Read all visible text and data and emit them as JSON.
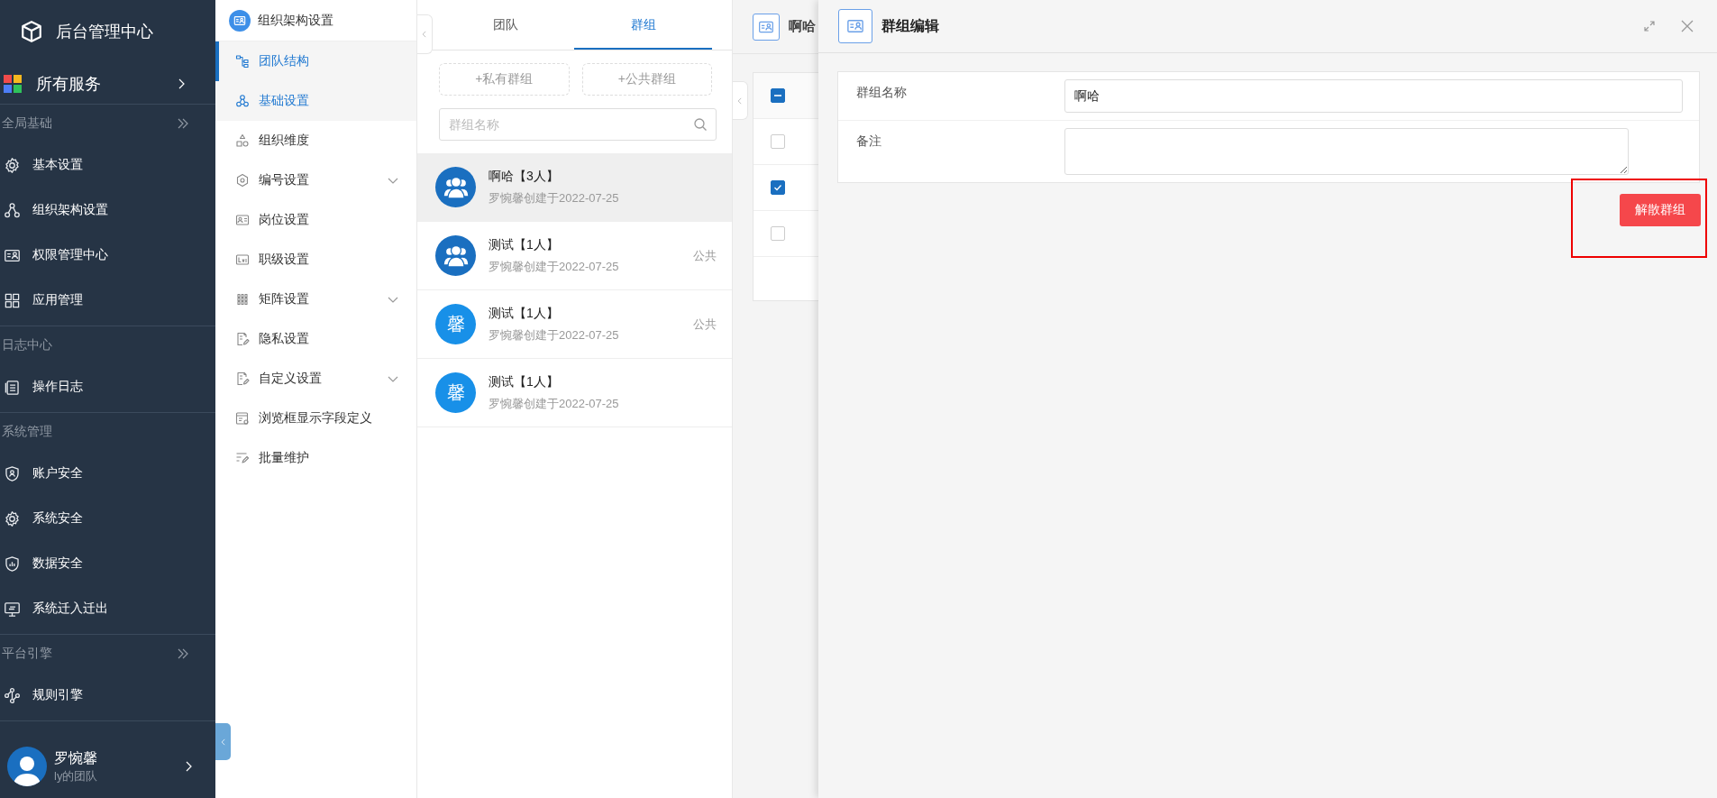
{
  "nav": {
    "title": "后台管理中心",
    "all_services": "所有服务",
    "sections": [
      {
        "title": "全局基础",
        "has_toggle": true,
        "items": [
          {
            "label": "基本设置",
            "kind": "gear"
          },
          {
            "label": "组织架构设置",
            "kind": "org"
          },
          {
            "label": "权限管理中心",
            "kind": "card"
          },
          {
            "label": "应用管理",
            "kind": "grid"
          }
        ]
      },
      {
        "title": "日志中心",
        "has_toggle": false,
        "items": [
          {
            "label": "操作日志",
            "kind": "log"
          }
        ]
      },
      {
        "title": "系统管理",
        "has_toggle": false,
        "items": [
          {
            "label": "账户安全",
            "kind": "shield_user"
          },
          {
            "label": "系统安全",
            "kind": "gear"
          },
          {
            "label": "数据安全",
            "kind": "shield_chart"
          },
          {
            "label": "系统迁入迁出",
            "kind": "monitor"
          }
        ]
      },
      {
        "title": "平台引擎",
        "has_toggle": true,
        "items": [
          {
            "label": "规则引擎",
            "kind": "flow"
          }
        ]
      }
    ],
    "user": {
      "name": "罗惋馨",
      "team": "ly的团队"
    }
  },
  "org_menu": {
    "title": "组织架构设置",
    "items": [
      {
        "label": "团队结构",
        "kind": "tree",
        "selected": true,
        "hovered": false,
        "expandable": false
      },
      {
        "label": "基础设置",
        "kind": "circles",
        "selected": false,
        "hovered": true,
        "expandable": false
      },
      {
        "label": "组织维度",
        "kind": "shapes",
        "selected": false,
        "hovered": false,
        "expandable": false
      },
      {
        "label": "编号设置",
        "kind": "hexagon",
        "selected": false,
        "hovered": false,
        "expandable": true
      },
      {
        "label": "岗位设置",
        "kind": "idcard",
        "selected": false,
        "hovered": false,
        "expandable": false
      },
      {
        "label": "职级设置",
        "kind": "level",
        "selected": false,
        "hovered": false,
        "expandable": false
      },
      {
        "label": "矩阵设置",
        "kind": "dots",
        "selected": false,
        "hovered": false,
        "expandable": true
      },
      {
        "label": "隐私设置",
        "kind": "docedit",
        "selected": false,
        "hovered": false,
        "expandable": false
      },
      {
        "label": "自定义设置",
        "kind": "docedit",
        "selected": false,
        "hovered": false,
        "expandable": true
      },
      {
        "label": "浏览框显示字段定义",
        "kind": "window",
        "selected": false,
        "hovered": false,
        "expandable": false
      },
      {
        "label": "批量维护",
        "kind": "listedit",
        "selected": false,
        "hovered": false,
        "expandable": false
      }
    ]
  },
  "group_panel": {
    "tabs": [
      {
        "label": "团队",
        "selected": false
      },
      {
        "label": "群组",
        "selected": true
      }
    ],
    "buttons": [
      "+私有群组",
      "+公共群组"
    ],
    "search": {
      "placeholder": "群组名称"
    },
    "groups": [
      {
        "name": "啊哈【3人】",
        "meta": "罗惋馨创建于2022-07-25",
        "kind": "people",
        "selected": true
      },
      {
        "name": "测试【1人】",
        "meta": "罗惋馨创建于2022-07-25",
        "kind": "people",
        "tag": "公共",
        "selected": false
      },
      {
        "name": "测试【1人】",
        "meta": "罗惋馨创建于2022-07-25",
        "kind": "char",
        "avatar_text": "馨",
        "tag": "公共",
        "selected": false
      },
      {
        "name": "测试【1人】",
        "meta": "罗惋馨创建于2022-07-25",
        "kind": "char",
        "avatar_text": "馨",
        "selected": false
      }
    ]
  },
  "member_view": {
    "title": "啊哈",
    "header_checkbox": {
      "indeterminate": true
    },
    "rows": [
      {
        "checked": false
      },
      {
        "checked": true
      },
      {
        "checked": false
      }
    ]
  },
  "drawer": {
    "title": "群组编辑",
    "fields": [
      {
        "label": "群组名称",
        "kind": "input",
        "value": "啊哈"
      },
      {
        "label": "备注",
        "kind": "textarea"
      }
    ],
    "button": "解散群组",
    "highlight": true
  }
}
